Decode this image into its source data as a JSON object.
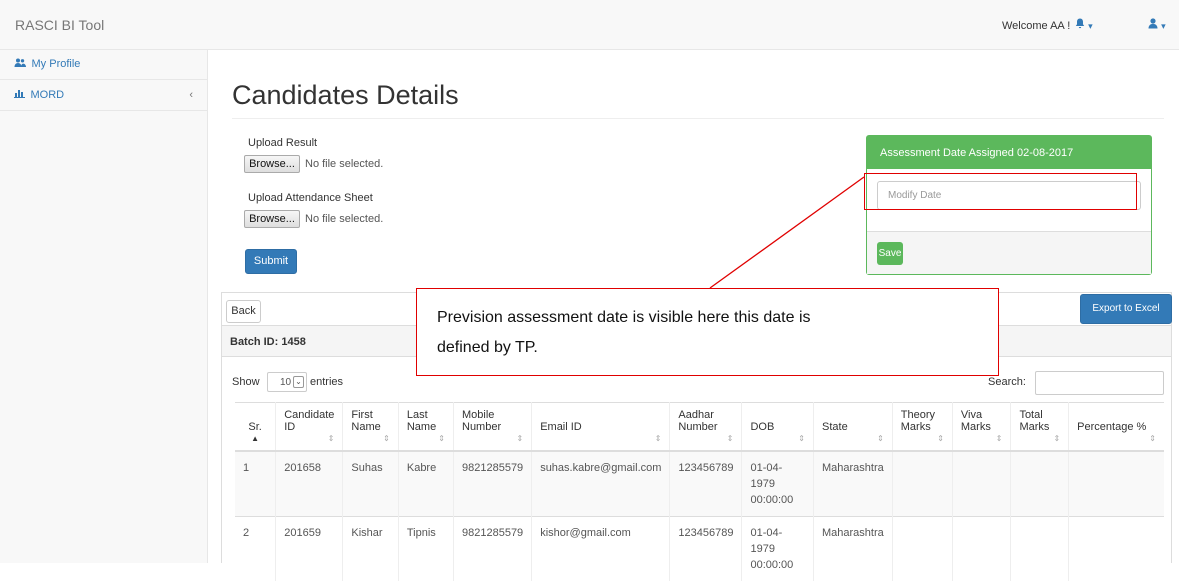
{
  "navbar": {
    "brand": "RASCI BI Tool",
    "welcome": "Welcome AA !",
    "bell_caret": "▾",
    "user_caret": "▾"
  },
  "sidebar": {
    "items": [
      {
        "label": "My Profile",
        "icon": "users-icon"
      },
      {
        "label": "MORD",
        "icon": "bar-chart-icon",
        "caret": "‹"
      }
    ]
  },
  "main": {
    "title": "Candidates Details",
    "upload_result_label": "Upload Result",
    "upload_attendance_label": "Upload Attendance Sheet",
    "browse_label": "Browse...",
    "no_file_text": "No file selected.",
    "submit_label": "Submit"
  },
  "assessment_panel": {
    "heading": "Assessment Date Assigned 02-08-2017",
    "modify_placeholder": "Modify Date",
    "save_label": "Save"
  },
  "table_panel": {
    "back_label": "Back",
    "export_label": "Export to Excel",
    "batch_label": "Batch ID: 1458",
    "show_label": "Show",
    "entries_value": "10",
    "entries_label": "entries",
    "search_label": "Search:",
    "sort_glyph": "⇕",
    "sort_asc_glyph": "▲",
    "columns": [
      "Sr.",
      "Candidate ID",
      "First Name",
      "Last Name",
      "Mobile Number",
      "Email ID",
      "Aadhar Number",
      "DOB",
      "State",
      "Theory Marks",
      "Viva Marks",
      "Total Marks",
      "Percentage %"
    ],
    "rows": [
      [
        "1",
        "201658",
        "Suhas",
        "Kabre",
        "9821285579",
        "suhas.kabre@gmail.com",
        "123456789",
        "01-04-1979 00:00:00",
        "Maharashtra",
        "",
        "",
        "",
        ""
      ],
      [
        "2",
        "201659",
        "Kishar",
        "Tipnis",
        "9821285579",
        "kishor@gmail.com",
        "123456789",
        "01-04-1979 00:00:00",
        "Maharashtra",
        "",
        "",
        "",
        ""
      ]
    ]
  },
  "annotation": {
    "line1": "Prevision assessment date is visible here this date is",
    "line2": "defined by TP."
  }
}
